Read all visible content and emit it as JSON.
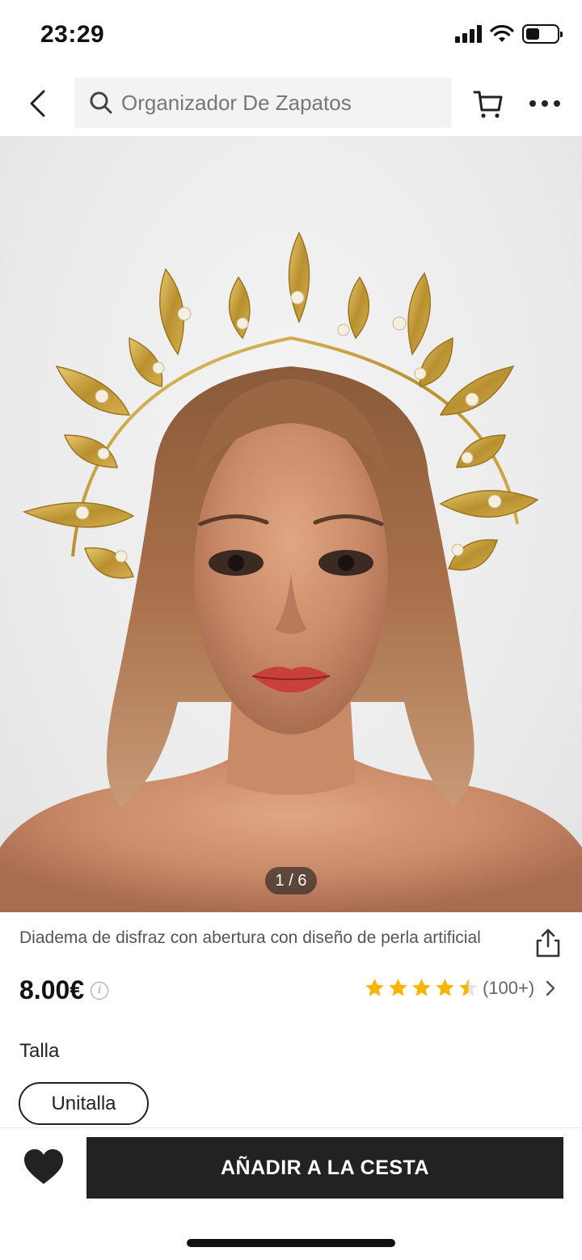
{
  "status_bar": {
    "time": "23:29",
    "battery_level": 0.45
  },
  "header": {
    "search_placeholder": "Organizador De Zapatos",
    "icons": [
      "back-chevron-icon",
      "search-icon",
      "cart-icon",
      "more-dots-icon"
    ]
  },
  "product": {
    "image_counter": "1 / 6",
    "title": "Diadema de disfraz con abertura con diseño de perla artificial",
    "price": "8.00€",
    "rating": {
      "stars": 4.5,
      "count_label": "(100+)",
      "star_color": "#f7b500"
    },
    "size_label": "Talla",
    "size_options": [
      "Unitalla"
    ]
  },
  "bottom_bar": {
    "add_to_cart_label": "AÑADIR A LA CESTA",
    "accent_color": "#222222"
  }
}
